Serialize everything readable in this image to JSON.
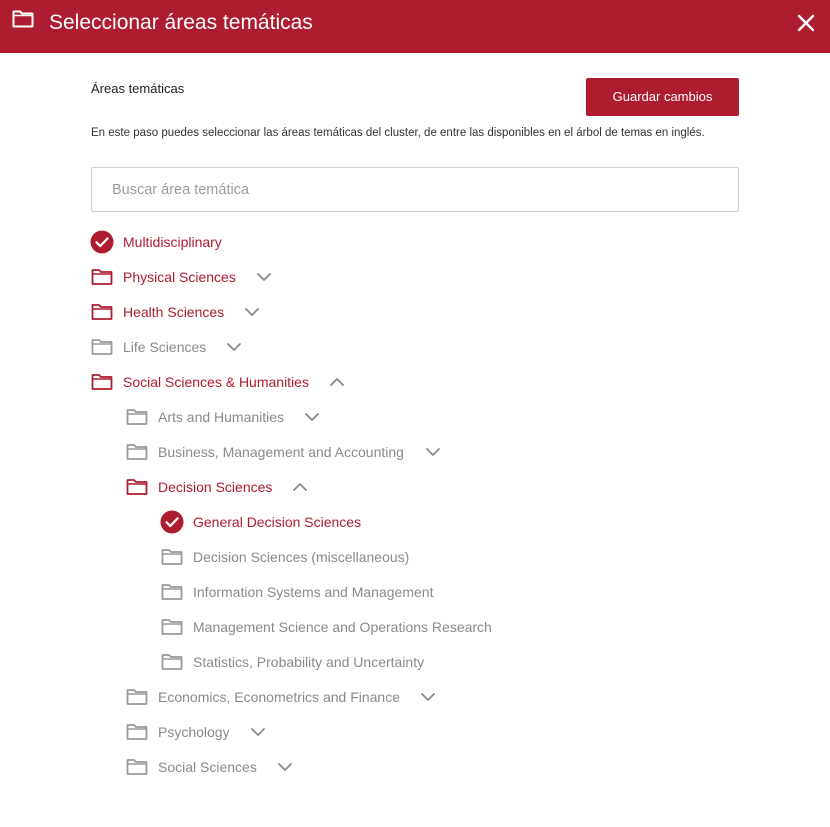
{
  "header": {
    "title": "Seleccionar áreas temáticas",
    "icon": "folder-icon"
  },
  "main": {
    "section_label": "Áreas temáticas",
    "save_label": "Guardar cambios",
    "description": "En este paso puedes seleccionar las áreas temáticas del cluster, de entre las disponibles en el árbol de temas en inglés.",
    "search": {
      "placeholder": "Buscar área temática",
      "value": ""
    }
  },
  "colors": {
    "accent": "#ae1c2f",
    "inactive": "#8a8a8a"
  },
  "tree": [
    {
      "label": "Multidisciplinary",
      "icon": "check-circle-icon",
      "state": "selected"
    },
    {
      "label": "Physical Sciences",
      "icon": "folder-icon",
      "state": "collapsed"
    },
    {
      "label": "Health Sciences",
      "icon": "folder-icon",
      "state": "collapsed"
    },
    {
      "label": "Life Sciences",
      "icon": "folder-icon",
      "state": "collapsed"
    },
    {
      "label": "Social Sciences & Humanities",
      "icon": "folder-icon",
      "state": "expanded",
      "children": [
        {
          "label": "Arts and Humanities",
          "icon": "folder-icon",
          "state": "collapsed"
        },
        {
          "label": "Business, Management and Accounting",
          "icon": "folder-icon",
          "state": "collapsed"
        },
        {
          "label": "Decision Sciences",
          "icon": "folder-icon",
          "state": "expanded",
          "children": [
            {
              "label": "General Decision Sciences",
              "icon": "check-circle-icon",
              "state": "selected"
            },
            {
              "label": "Decision Sciences (miscellaneous)",
              "icon": "folder-icon",
              "state": "unselected"
            },
            {
              "label": "Information Systems and Management",
              "icon": "folder-icon",
              "state": "unselected"
            },
            {
              "label": "Management Science and Operations Research",
              "icon": "folder-icon",
              "state": "unselected"
            },
            {
              "label": "Statistics, Probability and Uncertainty",
              "icon": "folder-icon",
              "state": "unselected"
            }
          ]
        },
        {
          "label": "Economics, Econometrics and Finance",
          "icon": "folder-icon",
          "state": "collapsed"
        },
        {
          "label": "Psychology",
          "icon": "folder-icon",
          "state": "collapsed"
        },
        {
          "label": "Social Sciences",
          "icon": "folder-icon",
          "state": "collapsed"
        }
      ]
    }
  ]
}
